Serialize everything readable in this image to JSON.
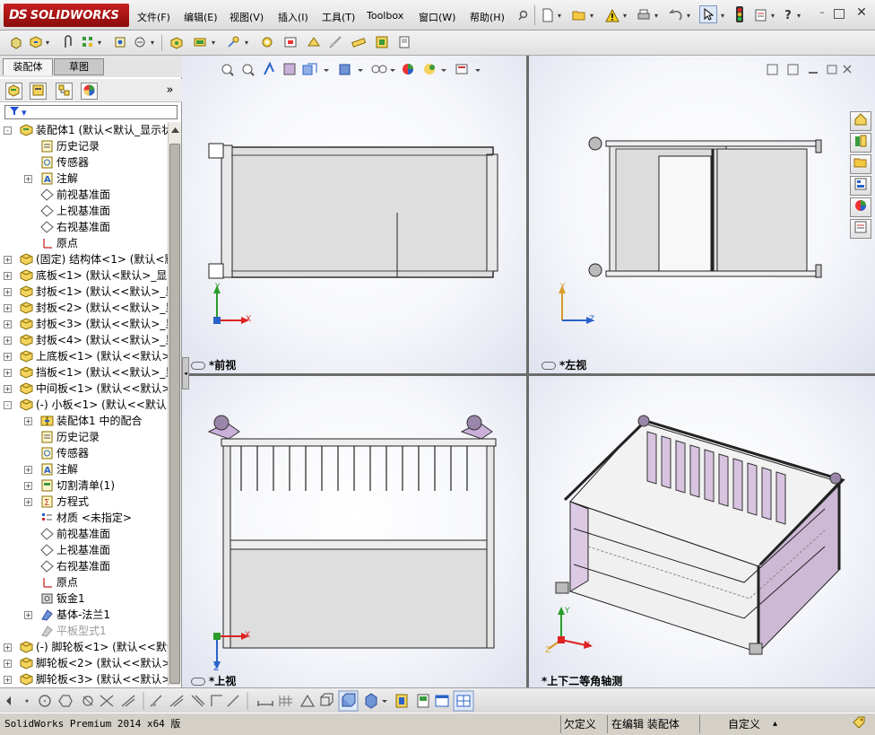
{
  "app": {
    "logo_prefix": "DS",
    "logo_text": "SOLIDWORKS"
  },
  "menu": [
    {
      "label": "文件(F)"
    },
    {
      "label": "编辑(E)"
    },
    {
      "label": "视图(V)"
    },
    {
      "label": "插入(I)"
    },
    {
      "label": "工具(T)"
    },
    {
      "label": "Toolbox"
    },
    {
      "label": "窗口(W)"
    },
    {
      "label": "帮助(H)"
    }
  ],
  "left_panel": {
    "tabs": [
      {
        "label": "装配体",
        "active": true
      },
      {
        "label": "草图",
        "active": false
      }
    ],
    "manager_icons": [
      "feature-manager-icon",
      "property-manager-icon",
      "configuration-manager-icon",
      "display-manager-icon"
    ],
    "expand_glyph": "»",
    "tree": [
      {
        "indent": 0,
        "expander": "-",
        "icon": "assembly-icon",
        "label": "装配体1 (默认<默认_显示状态"
      },
      {
        "indent": 1,
        "expander": "",
        "icon": "history-icon",
        "label": "历史记录"
      },
      {
        "indent": 1,
        "expander": "",
        "icon": "sensor-icon",
        "label": "传感器"
      },
      {
        "indent": 1,
        "expander": "+",
        "icon": "annotation-icon",
        "label": "注解"
      },
      {
        "indent": 1,
        "expander": "",
        "icon": "plane-icon",
        "label": "前视基准面"
      },
      {
        "indent": 1,
        "expander": "",
        "icon": "plane-icon",
        "label": "上视基准面"
      },
      {
        "indent": 1,
        "expander": "",
        "icon": "plane-icon",
        "label": "右视基准面"
      },
      {
        "indent": 1,
        "expander": "",
        "icon": "origin-icon",
        "label": "原点"
      },
      {
        "indent": 0,
        "expander": "+",
        "icon": "part-icon",
        "label": "(固定) 结构体<1> (默认<默"
      },
      {
        "indent": 0,
        "expander": "+",
        "icon": "part-icon",
        "label": "底板<1> (默认<默认>_显示"
      },
      {
        "indent": 0,
        "expander": "+",
        "icon": "part-icon",
        "label": "封板<1> (默认<<默认>_显示"
      },
      {
        "indent": 0,
        "expander": "+",
        "icon": "part-icon",
        "label": "封板<2> (默认<<默认>_显示"
      },
      {
        "indent": 0,
        "expander": "+",
        "icon": "part-icon",
        "label": "封板<3> (默认<<默认>_显示"
      },
      {
        "indent": 0,
        "expander": "+",
        "icon": "part-icon",
        "label": "封板<4> (默认<<默认>_显示"
      },
      {
        "indent": 0,
        "expander": "+",
        "icon": "part-icon",
        "label": "上底板<1> (默认<<默认>_显"
      },
      {
        "indent": 0,
        "expander": "+",
        "icon": "part-icon",
        "label": "挡板<1> (默认<<默认>_显示"
      },
      {
        "indent": 0,
        "expander": "+",
        "icon": "part-icon",
        "label": "中间板<1> (默认<<默认>_显"
      },
      {
        "indent": 0,
        "expander": "-",
        "icon": "part-icon",
        "label": "(-) 小板<1> (默认<<默认>_"
      },
      {
        "indent": 1,
        "expander": "+",
        "icon": "mates-icon",
        "label": "装配体1 中的配合"
      },
      {
        "indent": 1,
        "expander": "",
        "icon": "history-icon",
        "label": "历史记录"
      },
      {
        "indent": 1,
        "expander": "",
        "icon": "sensor-icon",
        "label": "传感器"
      },
      {
        "indent": 1,
        "expander": "+",
        "icon": "annotation-icon",
        "label": "注解"
      },
      {
        "indent": 1,
        "expander": "+",
        "icon": "cutlist-icon",
        "label": "切割清单(1)"
      },
      {
        "indent": 1,
        "expander": "+",
        "icon": "equation-icon",
        "label": "方程式"
      },
      {
        "indent": 1,
        "expander": "",
        "icon": "material-icon",
        "label": "材质 <未指定>"
      },
      {
        "indent": 1,
        "expander": "",
        "icon": "plane-icon",
        "label": "前视基准面"
      },
      {
        "indent": 1,
        "expander": "",
        "icon": "plane-icon",
        "label": "上视基准面"
      },
      {
        "indent": 1,
        "expander": "",
        "icon": "plane-icon",
        "label": "右视基准面"
      },
      {
        "indent": 1,
        "expander": "",
        "icon": "origin-icon",
        "label": "原点"
      },
      {
        "indent": 1,
        "expander": "",
        "icon": "sheetmetal-icon",
        "label": "钣金1"
      },
      {
        "indent": 1,
        "expander": "+",
        "icon": "baseflange-icon",
        "label": "基体-法兰1"
      },
      {
        "indent": 1,
        "expander": "",
        "icon": "flatpattern-icon",
        "label": "平板型式1",
        "muted": true
      },
      {
        "indent": 0,
        "expander": "+",
        "icon": "part-icon",
        "label": "(-) 脚轮板<1> (默认<<默认"
      },
      {
        "indent": 0,
        "expander": "+",
        "icon": "part-icon",
        "label": "脚轮板<2> (默认<<默认>_显"
      },
      {
        "indent": 0,
        "expander": "+",
        "icon": "part-icon",
        "label": "脚轮板<3> (默认<<默认>_显"
      }
    ]
  },
  "viewports": {
    "front": {
      "label": "*前视",
      "axes": [
        "Y",
        "X"
      ]
    },
    "left": {
      "label": "*左视",
      "axes": [
        "Y",
        "Z"
      ]
    },
    "top": {
      "label": "*上视",
      "axes": [
        "X",
        "Z"
      ]
    },
    "iso": {
      "label": "*上下二等角轴测",
      "axes": [
        "Y",
        "X",
        "Z"
      ]
    }
  },
  "status": {
    "version": "SolidWorks Premium 2014 x64 版",
    "state1": "欠定义",
    "state2": "在编辑 装配体",
    "state3": "自定义",
    "caret": "▴"
  }
}
